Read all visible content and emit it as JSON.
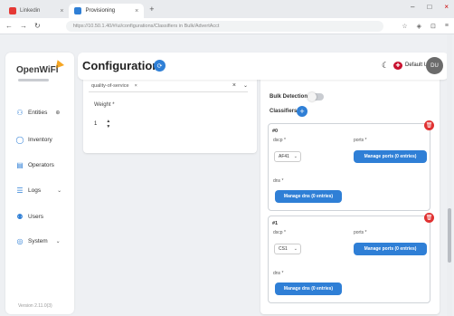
{
  "browser": {
    "tabs": [
      {
        "label": "Linkedin",
        "active": false
      },
      {
        "label": "Provisioning",
        "active": true
      }
    ],
    "url": "https://10.50.1.40/#/ui/configurations/Classifiers in Bulk/AdvertAcct",
    "new_tab": "+",
    "close_glyph": "×"
  },
  "sidebar": {
    "logo": "OpenWiFi",
    "items": [
      {
        "label": "Entities",
        "icon": "entities-icon",
        "glyph": "⚇",
        "chev": "⊕"
      },
      {
        "label": "Inventory",
        "icon": "inventory-icon",
        "glyph": "◯",
        "chev": ""
      },
      {
        "label": "Operators",
        "icon": "operators-icon",
        "glyph": "▤",
        "chev": ""
      },
      {
        "label": "Logs",
        "icon": "logs-icon",
        "glyph": "☰",
        "chev": "⌄"
      },
      {
        "label": "Users",
        "icon": "users-icon",
        "glyph": "⚉",
        "chev": ""
      },
      {
        "label": "System",
        "icon": "system-icon",
        "glyph": "◎",
        "chev": "⌄"
      }
    ],
    "version": "Version 2.11.0(3)"
  },
  "header": {
    "title": "Configuration",
    "user_label": "Default User",
    "avatar": "DU"
  },
  "left_panel": {
    "chip": "quality-of-service",
    "weight_label": "Weight",
    "weight_value": "1"
  },
  "right_panel": {
    "bulk_label": "Bulk Detection",
    "classifiers_label": "Classifiers",
    "classifiers": [
      {
        "name": "#0",
        "dscp_label": "dscp",
        "ports_label": "ports",
        "dscp_value": "AF41",
        "ports_button": "Manage ports (0 entries)",
        "dns_label": "dns",
        "dns_button": "Manage dns (0 entries)"
      },
      {
        "name": "#1",
        "dscp_label": "dscp",
        "ports_label": "ports",
        "dscp_value": "CS1",
        "ports_button": "Manage ports (0 entries)",
        "dns_label": "dns",
        "dns_button": "Manage dns (0 entries)"
      }
    ]
  },
  "colors": {
    "primary": "#2f7fd6",
    "danger": "#e03131",
    "accent_logo": "#f6a623"
  }
}
